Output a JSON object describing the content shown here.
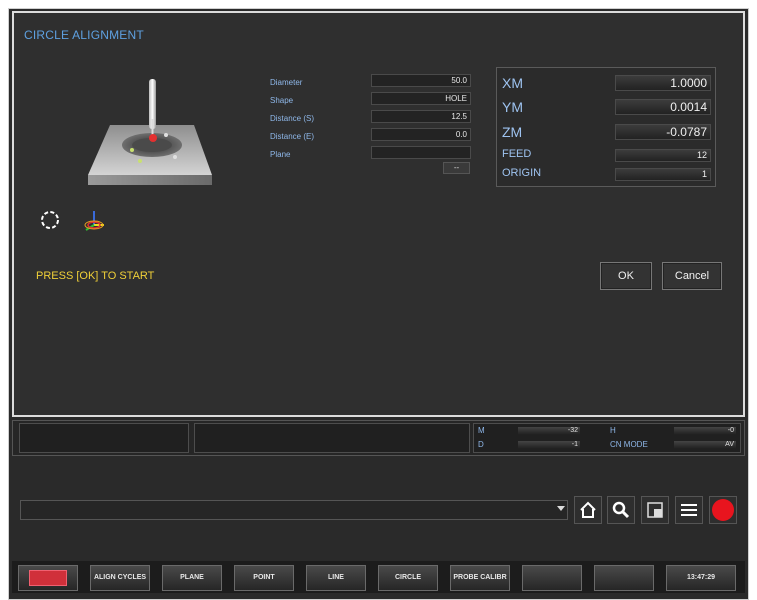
{
  "title": "CIRCLE ALIGNMENT",
  "params": [
    {
      "label": "Diameter",
      "value": "50.0"
    },
    {
      "label": "Shape",
      "value": "HOLE"
    },
    {
      "label": "Distance (S)",
      "value": "12.5"
    },
    {
      "label": "Distance (E)",
      "value": "0.0"
    },
    {
      "label": "Plane",
      "value": ""
    }
  ],
  "unit_button": "--",
  "readouts": [
    {
      "label": "XM",
      "value": "1.0000"
    },
    {
      "label": "YM",
      "value": "0.0014"
    },
    {
      "label": "ZM",
      "value": "-0.0787"
    },
    {
      "label": "FEED",
      "value": "12"
    },
    {
      "label": "ORIGIN",
      "value": "1"
    }
  ],
  "status_message": "PRESS [OK] TO START",
  "ok_label": "OK",
  "cancel_label": "Cancel",
  "strip": {
    "m_label": "M",
    "m_value": "-32",
    "d_label": "D",
    "d_value": "-1",
    "h_label": "H",
    "h_value": "-0",
    "cn_mode_label": "CN MODE",
    "cn_mode_value": "AV"
  },
  "softkeys": [
    "",
    "ALIGN CYCLES",
    "PLANE",
    "POINT",
    "LINE",
    "CIRCLE",
    "PROBE CALIBR",
    "",
    "",
    "13:47:29"
  ],
  "colors": {
    "accent": "#5ea0e0",
    "message": "#f0d038",
    "record": "#e8141e",
    "softkey_active": "#d0303a"
  },
  "icons": [
    "circle-pattern-icon",
    "axis-icon",
    "home-icon",
    "search-icon",
    "window-icon",
    "menu-icon",
    "record-icon",
    "dropdown-arrow-icon"
  ]
}
